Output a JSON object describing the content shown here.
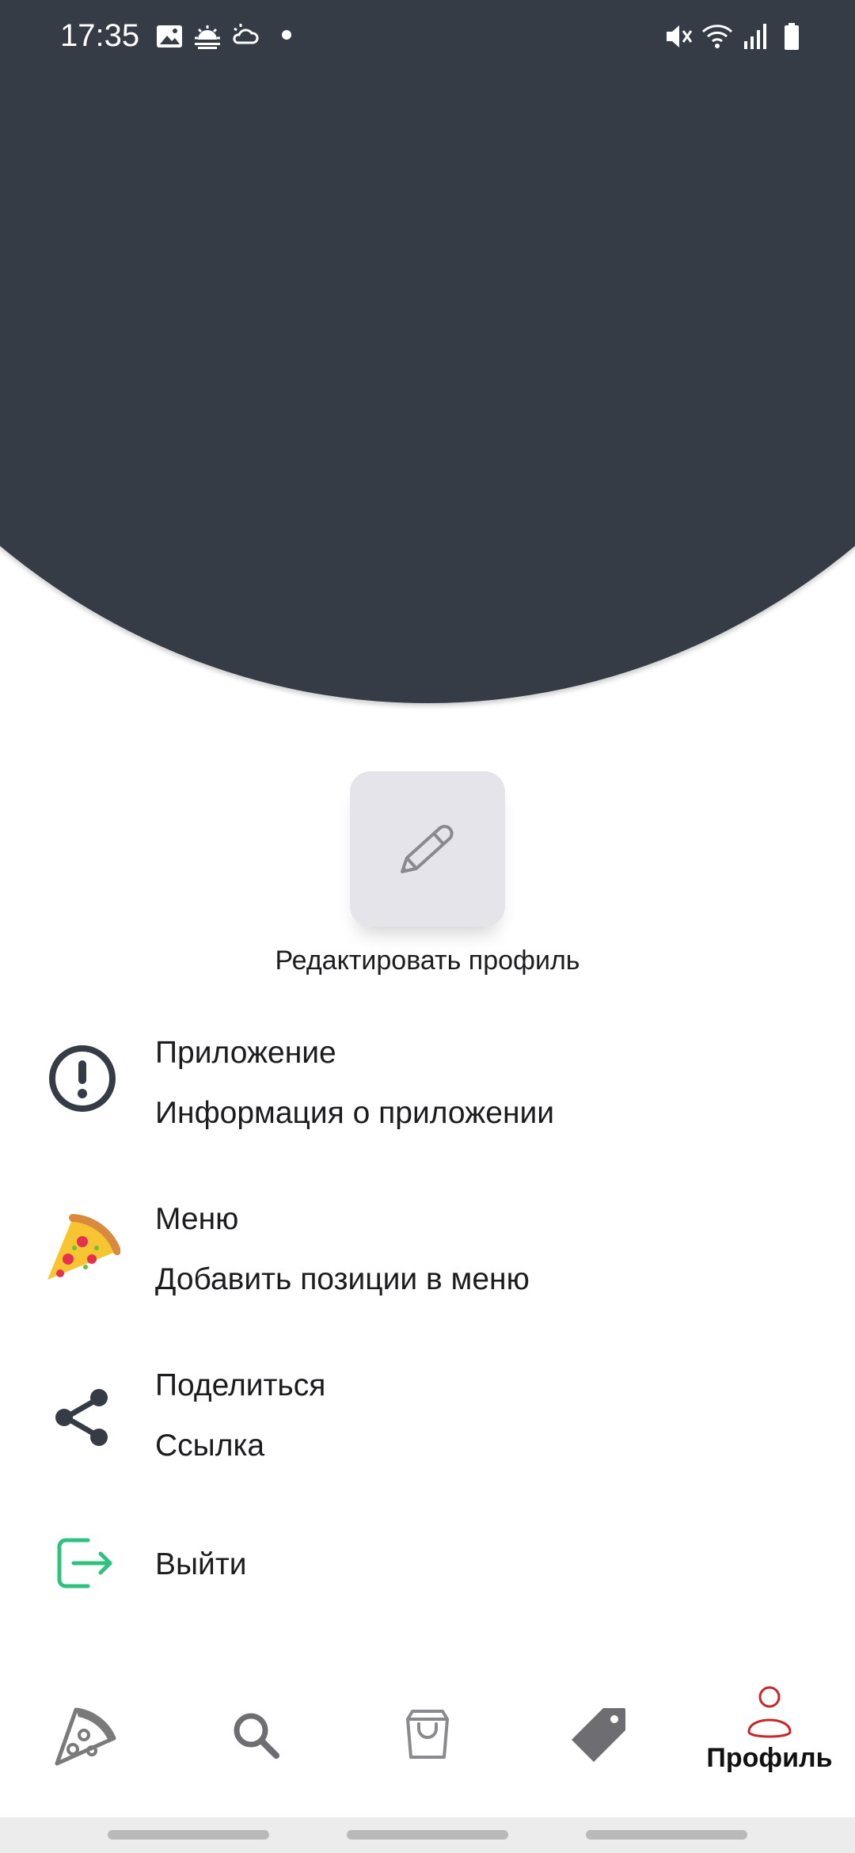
{
  "status_bar": {
    "time": "17:35",
    "icons": [
      "image-icon",
      "sunrise-icon",
      "weather-icon",
      "dot-icon",
      "mute-icon",
      "wifi-icon",
      "signal-icon",
      "battery-icon"
    ]
  },
  "profile": {
    "edit_label": "Редактировать профиль",
    "edit_icon": "pencil-icon"
  },
  "menu": {
    "items": [
      {
        "icon": "info-icon",
        "title": "Приложение",
        "subtitle": "Информация о приложении"
      },
      {
        "icon": "pizza-icon",
        "title": "Меню",
        "subtitle": "Добавить позиции в меню"
      },
      {
        "icon": "share-icon",
        "title": "Поделиться",
        "subtitle": "Ссылка"
      },
      {
        "icon": "logout-icon",
        "title": "Выйти"
      }
    ]
  },
  "bottom_nav": {
    "tabs": [
      {
        "icon": "pizza-slice-icon",
        "label": ""
      },
      {
        "icon": "search-icon",
        "label": ""
      },
      {
        "icon": "shopping-bag-icon",
        "label": ""
      },
      {
        "icon": "tag-icon",
        "label": ""
      },
      {
        "icon": "user-icon",
        "label": "Профиль",
        "active": true
      }
    ]
  },
  "colors": {
    "header": "#363c45",
    "active_tab": "#c62828",
    "logout_icon": "#2ec27e",
    "inactive_tab": "#7a7a7a"
  }
}
